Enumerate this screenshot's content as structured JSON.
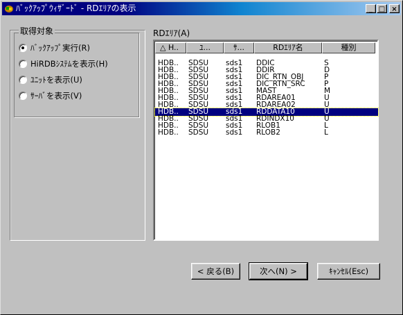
{
  "window": {
    "title": "ﾊﾞｯｸｱｯﾌﾟｳｨｻﾞｰﾄﾞ - RDｴﾘｱの表示",
    "minimize_glyph": "_",
    "maximize_glyph": "□",
    "close_glyph": "×"
  },
  "acquisition": {
    "title": "取得対象",
    "options": [
      {
        "label": "ﾊﾞｯｸｱｯﾌﾟ実行(R)",
        "selected": true
      },
      {
        "label": "HiRDBｼｽﾃﾑを表示(H)",
        "selected": false
      },
      {
        "label": "ﾕﾆｯﾄを表示(U)",
        "selected": false
      },
      {
        "label": "ｻｰﾊﾞを表示(V)",
        "selected": false
      }
    ]
  },
  "rdarea": {
    "label": "RDｴﾘｱ(A)",
    "columns": [
      "△ H..",
      "ﾕ...",
      "ｻ...",
      "RDｴﾘｱ名",
      "種別"
    ],
    "rows": [
      [
        "HDB..",
        "SDSU",
        "sds1",
        "DDIC",
        "S"
      ],
      [
        "HDB..",
        "SDSU",
        "sds1",
        "DDIR",
        "D"
      ],
      [
        "HDB..",
        "SDSU",
        "sds1",
        "DIC_RTN_OBJ",
        "P"
      ],
      [
        "HDB..",
        "SDSU",
        "sds1",
        "DIC_RTN_SRC",
        "P"
      ],
      [
        "HDB..",
        "SDSU",
        "sds1",
        "MAST",
        "M"
      ],
      [
        "HDB..",
        "SDSU",
        "sds1",
        "RDAREA01",
        "U"
      ],
      [
        "HDB..",
        "SDSU",
        "sds1",
        "RDAREA02",
        "U"
      ],
      [
        "HDB..",
        "SDSU",
        "sds1",
        "RDDATA10",
        "U"
      ],
      [
        "HDB..",
        "SDSU",
        "sds1",
        "RDINDX10",
        "U"
      ],
      [
        "HDB..",
        "SDSU",
        "sds1",
        "RLOB1",
        "L"
      ],
      [
        "HDB..",
        "SDSU",
        "sds1",
        "RLOB2",
        "L"
      ]
    ],
    "selected_row": 7
  },
  "buttons": {
    "back": "< 戻る(B)",
    "next": "次へ(N) >",
    "cancel": "ｷｬﾝｾﾙ(Esc)"
  },
  "colors": {
    "titlebar_start": "#000080",
    "selection": "#000080",
    "face": "#c0c0c0"
  }
}
